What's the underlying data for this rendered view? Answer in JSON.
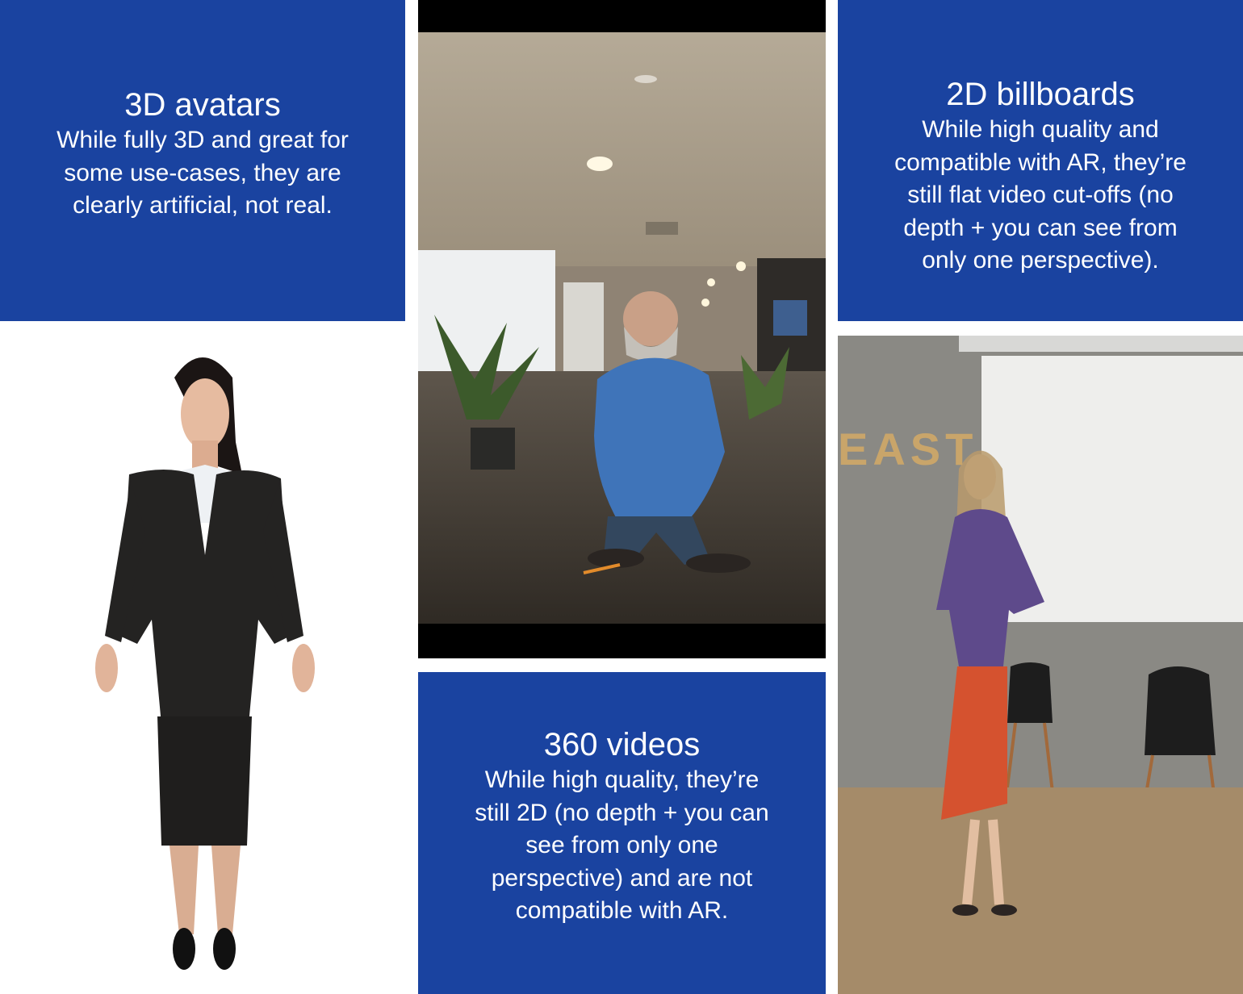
{
  "panels": {
    "avatars": {
      "title": "3D avatars",
      "description": "While fully 3D and great for\nsome use-cases, they are\nclearly artificial, not real."
    },
    "billboards": {
      "title": "2D billboards",
      "description": "While high quality and\ncompatible with AR, they’re\nstill flat video cut-offs (no\ndepth + you can see from\nonly one perspective)."
    },
    "videos360": {
      "title": "360 videos",
      "description": "While high quality, they’re\nstill 2D (no depth + you can\nsee from only one\nperspective) and are not\ncompatible with AR."
    }
  },
  "images": {
    "avatar": "3d-avatar-woman-business-suit",
    "video360": "360-video-man-in-lobby",
    "billboard": "2d-billboard-woman-on-stage",
    "stage_sign": "EAST"
  },
  "colors": {
    "panel_blue": "#1a43a0",
    "text": "#ffffff"
  }
}
